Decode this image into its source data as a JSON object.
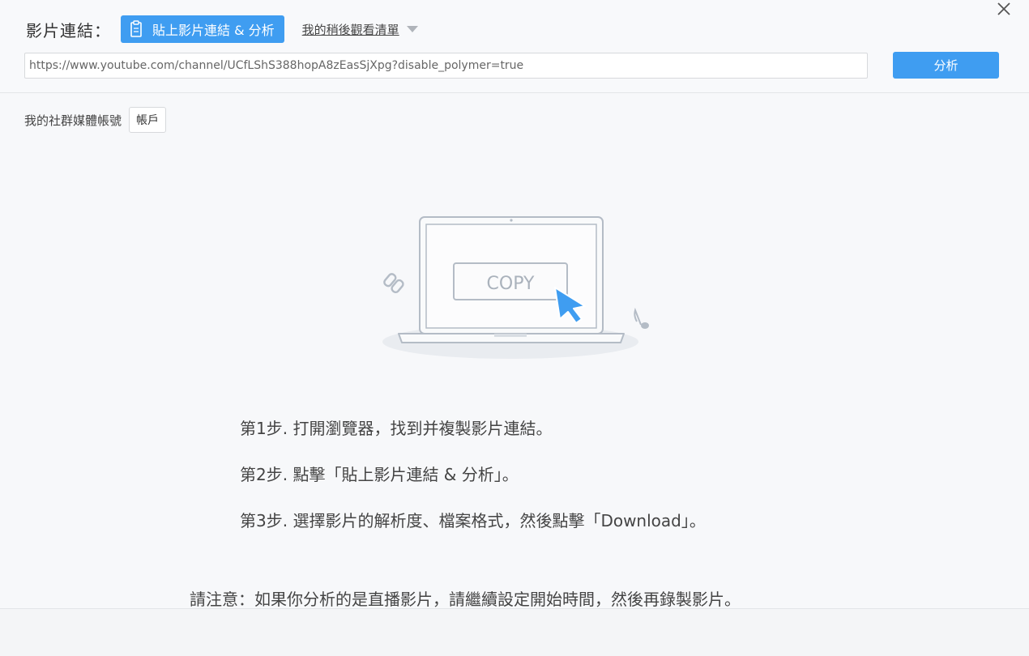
{
  "header": {
    "link_label": "影片連結：",
    "paste_button_label": "貼上影片連結 & 分析",
    "watch_later_label": "我的稍後觀看清單",
    "url_value": "https://www.youtube.com/channel/UCfLShS388hopA8zEasSjXpg?disable_polymer=true",
    "analyze_button_label": "分析"
  },
  "social": {
    "label": "我的社群媒體帳號",
    "account_button_label": "帳戶"
  },
  "illustration": {
    "copy_label": "COPY"
  },
  "steps": [
    "第1步. 打開瀏覽器，找到并複製影片連結。",
    "第2步. 點擊「貼上影片連結 & 分析」。",
    "第3步. 選擇影片的解析度、檔案格式，然後點擊「Download」。"
  ],
  "note": "請注意：如果你分析的是直播影片，請繼續設定開始時間，然後再錄製影片。",
  "colors": {
    "accent": "#3f9df1",
    "background": "#f7f8fa",
    "illustration_stroke": "#b4bcc6"
  },
  "icons": [
    "close-icon",
    "clipboard-icon",
    "caret-down-icon",
    "laptop-icon",
    "chain-link-icon",
    "cursor-arrow-icon",
    "music-note-icon"
  ]
}
